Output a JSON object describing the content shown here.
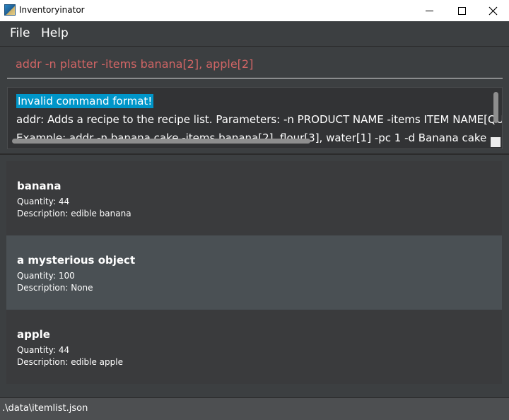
{
  "window": {
    "title": "Inventoryinator"
  },
  "menu": {
    "file": "File",
    "help": "Help"
  },
  "command": {
    "value": "addr -n platter -items banana[2], apple[2]"
  },
  "result": {
    "line1": "Invalid command format!",
    "line2": "addr: Adds a recipe to the recipe list. Parameters: -n PRODUCT NAME -items ITEM NAME[QU",
    "line3": "Example: addr -n banana cake -items banana[2], flour[3], water[1] -pc 1 -d Banana cake"
  },
  "items": [
    {
      "name": "banana",
      "quantity": "Quantity: 44",
      "description": "Description: edible banana",
      "selected": false
    },
    {
      "name": "a mysterious object",
      "quantity": "Quantity: 100",
      "description": "Description: None",
      "selected": true
    },
    {
      "name": "apple",
      "quantity": "Quantity: 44",
      "description": "Description: edible apple",
      "selected": false
    }
  ],
  "status": {
    "path": ".\\data\\itemlist.json"
  },
  "icons": {
    "app": "app-icon",
    "minimize": "minimize-icon",
    "maximize": "maximize-icon",
    "close": "close-icon"
  },
  "colors": {
    "background": "#3c3f41",
    "command_text": "#d16565",
    "highlight": "#0096c9",
    "selected_card": "#4a5054"
  }
}
